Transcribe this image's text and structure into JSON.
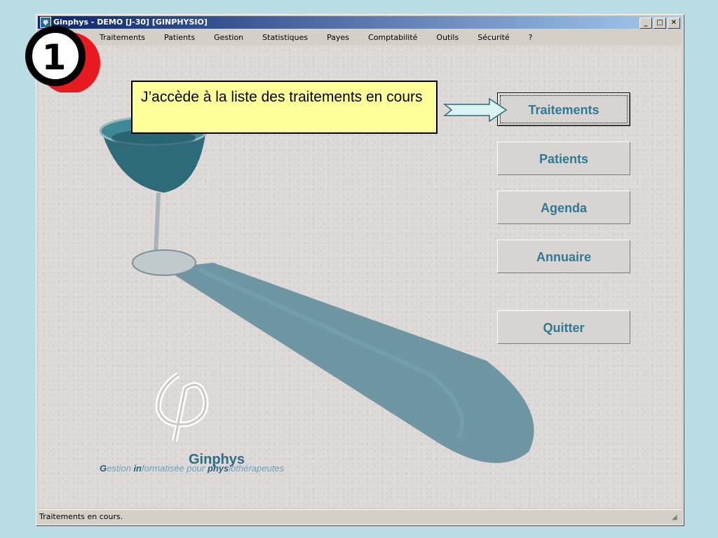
{
  "window": {
    "title": "Ginphys - DEMO [J-30] [GINPHYSIO]",
    "controls": {
      "minimize": "_",
      "maximize": "□",
      "close": "✕"
    }
  },
  "menu": [
    "Traitements",
    "Patients",
    "Gestion",
    "Statistiques",
    "Payes",
    "Comptabilité",
    "Outils",
    "Sécurité",
    "?"
  ],
  "buttons": {
    "traitements": "Traitements",
    "patients": "Patients",
    "agenda": "Agenda",
    "annuaire": "Annuaire",
    "quitter": "Quitter"
  },
  "logo": {
    "name": "Ginphys",
    "tagline_parts": [
      "G",
      "estion ",
      "in",
      "formatisée pour ",
      "phys",
      "iothérapeutes"
    ]
  },
  "statusbar": {
    "text": "Traitements en cours."
  },
  "callout": {
    "text": "J’accède à la liste des traitements en cours"
  },
  "step": {
    "number": "1",
    "color": "#e8191f"
  },
  "colors": {
    "button_text": "#2e7a94",
    "callout_bg": "#ffff99",
    "titlebar": "#0a246a"
  }
}
